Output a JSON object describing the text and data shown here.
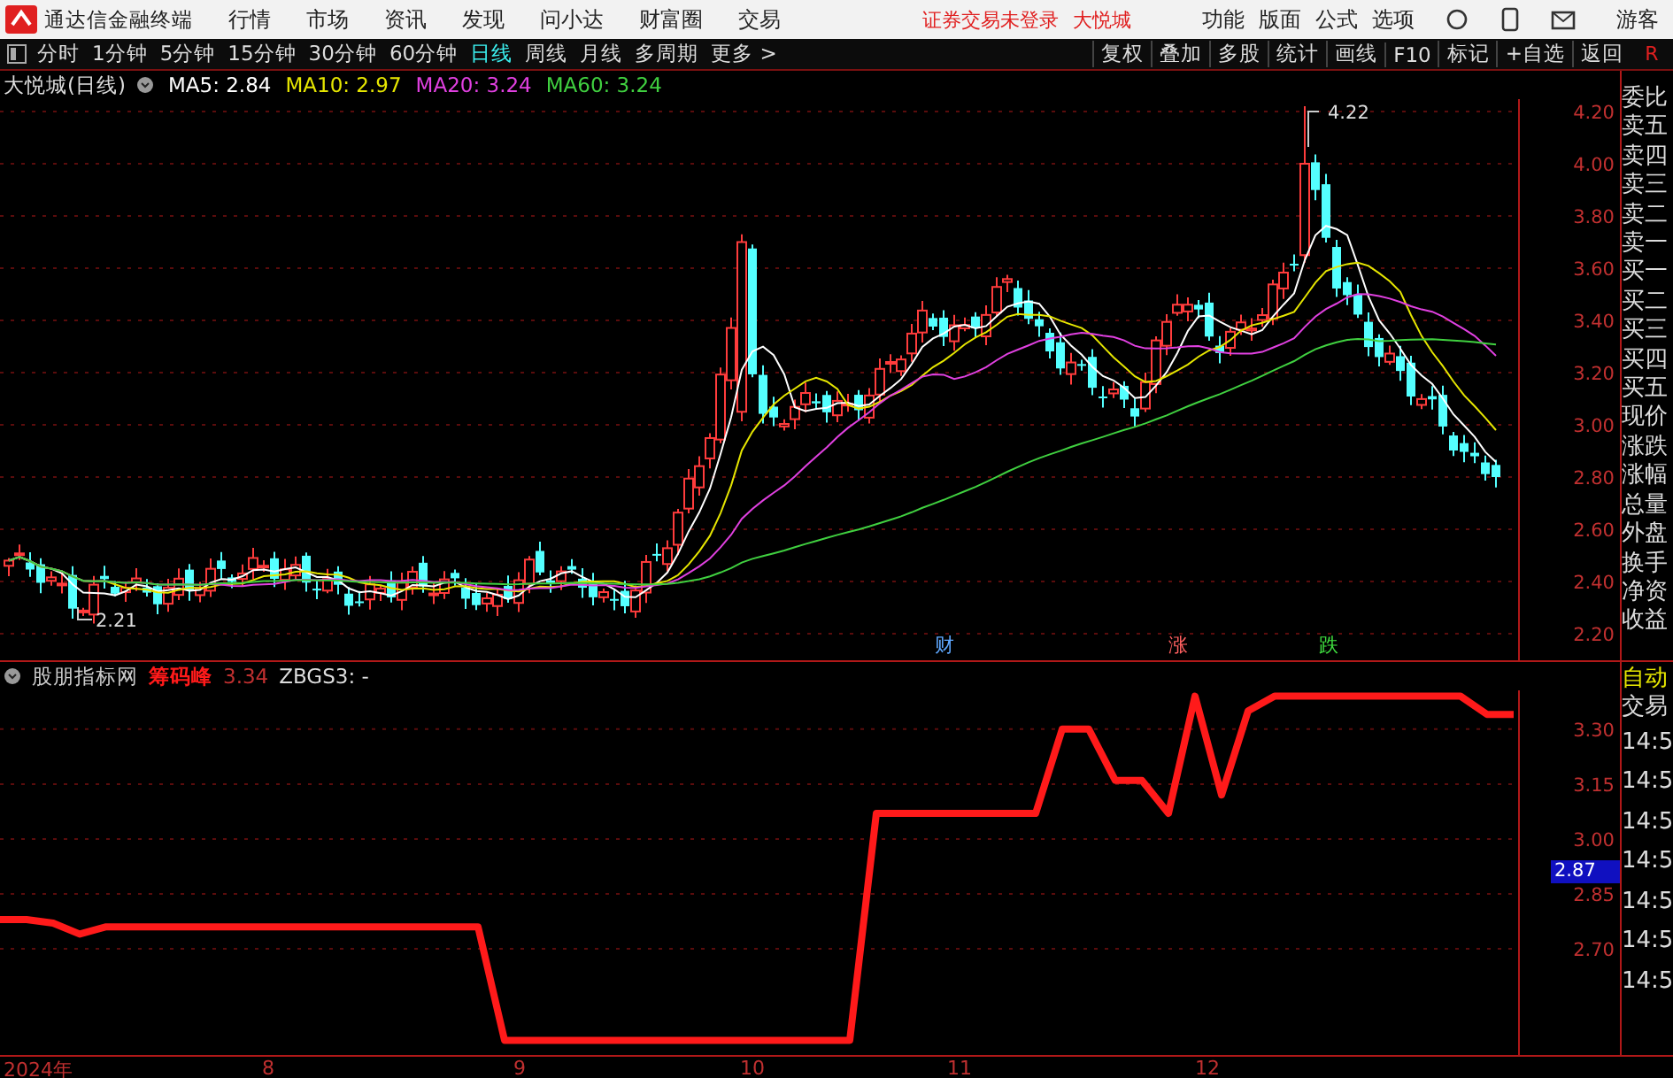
{
  "title_bar": {
    "app_name": "通达信金融终端",
    "menu": [
      "行情",
      "市场",
      "资讯",
      "发现",
      "问小达",
      "财富圈",
      "交易"
    ],
    "notice": "证券交易未登录",
    "stock": "大悦城",
    "right_menu": [
      "功能",
      "版面",
      "公式",
      "选项"
    ],
    "user": "游客"
  },
  "period_tabs": [
    {
      "label": "分时",
      "selected": false
    },
    {
      "label": "1分钟",
      "selected": false
    },
    {
      "label": "5分钟",
      "selected": false
    },
    {
      "label": "15分钟",
      "selected": false
    },
    {
      "label": "30分钟",
      "selected": false
    },
    {
      "label": "60分钟",
      "selected": false
    },
    {
      "label": "日线",
      "selected": true
    },
    {
      "label": "周线",
      "selected": false
    },
    {
      "label": "月线",
      "selected": false
    },
    {
      "label": "多周期",
      "selected": false
    },
    {
      "label": "更多 >",
      "selected": false
    }
  ],
  "tool_buttons": [
    "复权",
    "叠加",
    "多股",
    "统计",
    "画线",
    "F10",
    "标记",
    "+自选",
    "返回"
  ],
  "corner_label": "R",
  "main_chart": {
    "title": "大悦城(日线)",
    "ma": [
      {
        "label": "MA5: 2.84",
        "color": "#ffffff"
      },
      {
        "label": "MA10: 2.97",
        "color": "#e6e600"
      },
      {
        "label": "MA20: 3.24",
        "color": "#e040e0"
      },
      {
        "label": "MA60: 3.24",
        "color": "#40d040"
      }
    ],
    "price_ticks": [
      "4.20",
      "4.00",
      "3.80",
      "3.60",
      "3.40",
      "3.20",
      "3.00",
      "2.80",
      "2.60",
      "2.40",
      "2.20"
    ],
    "high_label": "4.22",
    "low_label": "2.21",
    "markers": [
      {
        "label": "财",
        "color": "#5fa8ff"
      },
      {
        "label": "涨",
        "color": "#ff6060"
      },
      {
        "label": "跌",
        "color": "#40e040"
      }
    ]
  },
  "indicator": {
    "source": "股朋指标网",
    "value": "3.34",
    "formula": "ZBGS3: -",
    "cursor_price": "2.87",
    "chart_data": {
      "type": "line",
      "grid": true,
      "ylim": [
        2.405,
        3.406
      ],
      "yticks": [
        {
          "value": 2.7,
          "label": "2.70"
        },
        {
          "value": 2.85,
          "label": "2.85"
        },
        {
          "value": 3.0,
          "label": "3.00"
        },
        {
          "value": 3.15,
          "label": "3.15"
        },
        {
          "value": 3.3,
          "label": "3.30"
        }
      ],
      "series": [
        {
          "name": "筹码峰",
          "color": "#ff1a1a",
          "values": [
            2.78,
            2.78,
            2.77,
            2.74,
            2.76,
            2.76,
            2.76,
            2.76,
            2.76,
            2.76,
            2.76,
            2.76,
            2.76,
            2.76,
            2.76,
            2.76,
            2.76,
            2.76,
            2.76,
            2.45,
            2.45,
            2.45,
            2.45,
            2.45,
            2.45,
            2.45,
            2.45,
            2.45,
            2.45,
            2.45,
            2.45,
            2.45,
            2.45,
            3.07,
            3.07,
            3.07,
            3.07,
            3.07,
            3.07,
            3.07,
            3.3,
            3.3,
            3.16,
            3.16,
            3.07,
            3.39,
            3.12,
            3.35,
            3.39,
            3.39,
            3.39,
            3.39,
            3.39,
            3.39,
            3.39,
            3.39,
            3.34,
            3.34
          ]
        }
      ]
    }
  },
  "quote_panel": {
    "labels": [
      "委比",
      "卖五",
      "卖四",
      "卖三",
      "卖二",
      "卖一",
      "买一",
      "买二",
      "买三",
      "买四",
      "买五",
      "现价",
      "涨跌",
      "涨幅",
      "总量",
      "外盘",
      "换手",
      "净资",
      "收益"
    ],
    "auto_label": "自动",
    "trade_label": "交易",
    "times": [
      "14:5",
      "14:5",
      "14:5",
      "14:5",
      "14:5",
      "14:5",
      "14:5"
    ]
  },
  "time_axis": [
    "2024年",
    "8",
    "9",
    "10",
    "11",
    "12"
  ]
}
